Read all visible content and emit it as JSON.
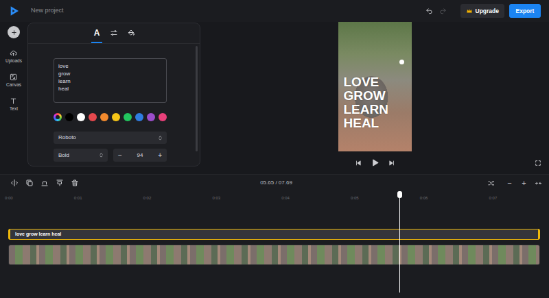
{
  "header": {
    "title": "New project",
    "undo": {
      "disabled": false
    },
    "redo": {
      "disabled": true
    },
    "upgrade": "Upgrade",
    "export": "Export"
  },
  "sidebar": {
    "items": [
      {
        "label": "Uploads",
        "kind": "upload"
      },
      {
        "label": "Canvas",
        "kind": "canvas"
      },
      {
        "label": "Text",
        "kind": "text"
      }
    ]
  },
  "panel": {
    "tabs": [
      {
        "kind": "letter",
        "label": "A",
        "selected": true
      },
      {
        "kind": "sliders",
        "selected": false
      },
      {
        "kind": "fill",
        "selected": false
      }
    ],
    "text": "love\ngrow\nlearn\nheal",
    "swatches": [
      {
        "kind": "picker"
      },
      {
        "kind": "color",
        "color": "#000000"
      },
      {
        "kind": "color",
        "color": "#ffffff"
      },
      {
        "kind": "color",
        "color": "#e5484d"
      },
      {
        "kind": "color",
        "color": "#f28a2e"
      },
      {
        "kind": "color",
        "color": "#f5c518"
      },
      {
        "kind": "color",
        "color": "#22c55e"
      },
      {
        "kind": "color",
        "color": "#2f7de1"
      },
      {
        "kind": "color",
        "color": "#9b4dca"
      },
      {
        "kind": "color",
        "color": "#e8407a"
      }
    ],
    "font": "Roboto",
    "weight": "Bold",
    "size": {
      "minus": "−",
      "value": "94",
      "plus": "+"
    }
  },
  "preview": {
    "lines": [
      "LOVE",
      "GROW",
      "LEARN",
      "HEAL"
    ]
  },
  "timeline": {
    "time": "05.65 / 07.69",
    "zoom_out": "−",
    "zoom_in": "+",
    "ruler": [
      "0:00",
      "0:01",
      "0:02",
      "0:03",
      "0:04",
      "0:05",
      "0:06",
      "0:07"
    ],
    "playhead": {
      "level": 0.735
    },
    "tracks": [
      {
        "kind": "text",
        "label": "love grow learn heal"
      },
      {
        "kind": "video"
      }
    ]
  }
}
